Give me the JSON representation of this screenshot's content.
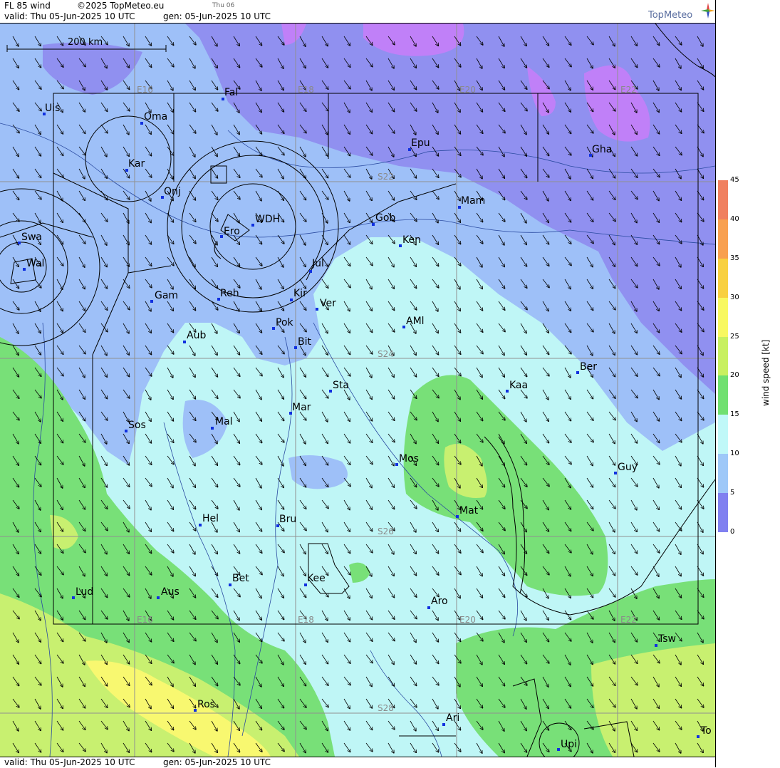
{
  "header": {
    "product": "FL 85 wind",
    "copyright": "©2025 TopMeteo.eu",
    "day": "Thu 06",
    "valid": "valid:  Thu  05-Jun-2025  10 UTC",
    "gen": "gen: 05-Jun-2025 10 UTC"
  },
  "footer": {
    "valid": "valid:  Thu  05-Jun-2025  10 UTC",
    "gen": "gen: 05-Jun-2025 10 UTC"
  },
  "logo": {
    "text": "TopMeteo"
  },
  "scale_bar": {
    "label": "200 km"
  },
  "colorbar": {
    "title": "wind speed  [kt]",
    "ticks": [
      "45",
      "40",
      "35",
      "30",
      "25",
      "20",
      "15",
      "10",
      "5",
      "0"
    ],
    "colors": [
      "#f08060",
      "#f8a050",
      "#f8d040",
      "#f8f860",
      "#c8f060",
      "#70e070",
      "#c0f8f8",
      "#9ec8f8",
      "#8080f0",
      "#c080f8"
    ]
  },
  "grid_labels": {
    "top": [
      "E16",
      "E18",
      "E20",
      "E22"
    ],
    "bottom": [
      "E16",
      "E18",
      "E20",
      "E22"
    ],
    "lat": [
      "S22",
      "S24",
      "S26",
      "S28"
    ]
  },
  "cities": [
    {
      "name": "Uis"
    },
    {
      "name": "Fal"
    },
    {
      "name": "Oma"
    },
    {
      "name": "Epu"
    },
    {
      "name": "Gha"
    },
    {
      "name": "Kar"
    },
    {
      "name": "Onj"
    },
    {
      "name": "Mam"
    },
    {
      "name": "Gob"
    },
    {
      "name": "WDH"
    },
    {
      "name": "Ero"
    },
    {
      "name": "Ken"
    },
    {
      "name": "Swa"
    },
    {
      "name": "Wal"
    },
    {
      "name": "Jul"
    },
    {
      "name": "Gam"
    },
    {
      "name": "Reh"
    },
    {
      "name": "Kir"
    },
    {
      "name": "Ver"
    },
    {
      "name": "Pok"
    },
    {
      "name": "AMl"
    },
    {
      "name": "Bit"
    },
    {
      "name": "Aub"
    },
    {
      "name": "Ber"
    },
    {
      "name": "Sta"
    },
    {
      "name": "Kaa"
    },
    {
      "name": "Mar"
    },
    {
      "name": "Sos"
    },
    {
      "name": "Mal"
    },
    {
      "name": "Mos"
    },
    {
      "name": "Guy"
    },
    {
      "name": "Mat"
    },
    {
      "name": "Hel"
    },
    {
      "name": "Bru"
    },
    {
      "name": "Bet"
    },
    {
      "name": "Kee"
    },
    {
      "name": "Lud"
    },
    {
      "name": "Aus"
    },
    {
      "name": "Aro"
    },
    {
      "name": "Tsw"
    },
    {
      "name": "Ros"
    },
    {
      "name": "Ari"
    },
    {
      "name": "Upi"
    },
    {
      "name": "To"
    }
  ],
  "wind_colors": {
    "purple": "#b088f0",
    "violet": "#9090f0",
    "blue": "#9ec0f8",
    "cyan": "#bff6f6",
    "green": "#78e078",
    "lime": "#c8f070",
    "yellow": "#f8f870"
  }
}
